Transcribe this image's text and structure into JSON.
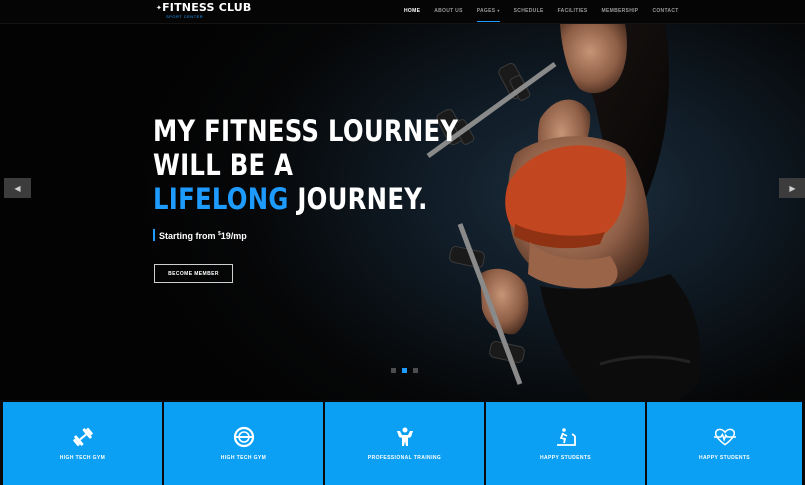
{
  "brand": {
    "name": "FITNESS CLUB",
    "tagline": "SPORT CENTER"
  },
  "nav": {
    "items": [
      {
        "label": "HOME",
        "active": true
      },
      {
        "label": "ABOUT US",
        "active": false
      },
      {
        "label": "PAGES",
        "active": false,
        "dropdown": true
      },
      {
        "label": "SCHEDULE",
        "active": false
      },
      {
        "label": "FACILITIES",
        "active": false
      },
      {
        "label": "MEMBERSHIP",
        "active": false
      },
      {
        "label": "CONTACT",
        "active": false
      }
    ]
  },
  "hero": {
    "line1": "MY FITNESS LOURNEY",
    "line2": "WILL BE A",
    "line3_highlight": "LIFELONG",
    "line3_rest": " JOURNEY.",
    "price_prefix": "Starting from ",
    "price_currency": "$",
    "price_value": "19/mp",
    "cta_label": "BECOME MEMBER",
    "slides": {
      "count": 3,
      "active_index": 1
    }
  },
  "features": [
    {
      "icon": "dumbbell-icon",
      "title": "HIGH TECH GYM"
    },
    {
      "icon": "weight-plate-icon",
      "title": "HIGH TECH GYM"
    },
    {
      "icon": "bodybuilder-icon",
      "title": "PROFESSIONAL TRAINING"
    },
    {
      "icon": "treadmill-icon",
      "title": "HAPPY STUDENTS"
    },
    {
      "icon": "heartbeat-icon",
      "title": "HAPPY STUDENTS"
    }
  ],
  "colors": {
    "accent": "#1e9bff",
    "tile": "#0ba0f3",
    "background": "#050505"
  }
}
